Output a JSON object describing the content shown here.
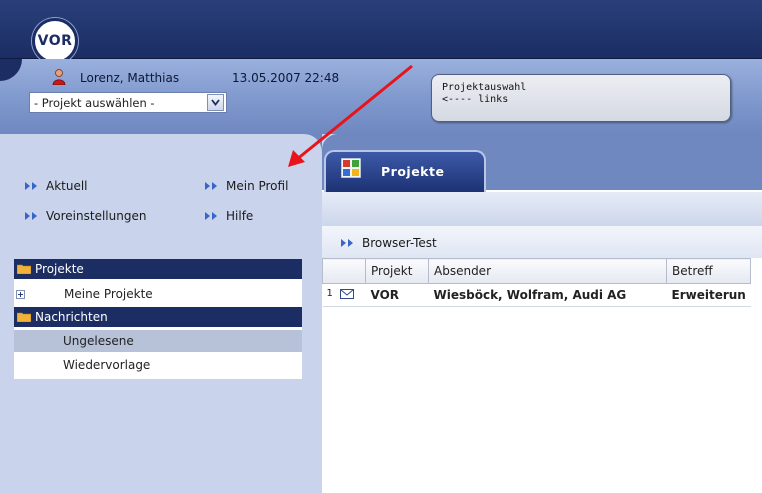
{
  "app": {
    "logo_text": "VOR"
  },
  "header": {
    "user_name": "Lorenz, Matthias",
    "datetime": "13.05.2007 22:48",
    "project_select": {
      "value": "- Projekt auswählen -"
    },
    "note": {
      "line1": "Projektauswahl",
      "line2": "<---- links"
    }
  },
  "nav": {
    "links": [
      {
        "label": "Aktuell"
      },
      {
        "label": "Mein Profil"
      },
      {
        "label": "Voreinstellungen"
      },
      {
        "label": "Hilfe"
      }
    ]
  },
  "tree": {
    "sections": [
      {
        "title": "Projekte",
        "items": [
          {
            "label": "Meine Projekte",
            "expandable": true
          }
        ]
      },
      {
        "title": "Nachrichten",
        "items": [
          {
            "label": "Ungelesene",
            "selected": true
          },
          {
            "label": "Wiedervorlage"
          }
        ]
      }
    ]
  },
  "main": {
    "tab_label": "Projekte",
    "breadcrumb": "Browser-Test",
    "table": {
      "columns": [
        "Projekt",
        "Absender",
        "Betreff"
      ],
      "rows": [
        {
          "num": "1",
          "icon": "envelope-icon",
          "projekt": "VOR",
          "absender": "Wiesböck, Wolfram, Audi AG",
          "betreff": "Erweiterun"
        }
      ]
    }
  },
  "colors": {
    "navy": "#1b2d63",
    "panel": "#c9d4ec",
    "annotation_arrow": "#e8141c"
  }
}
